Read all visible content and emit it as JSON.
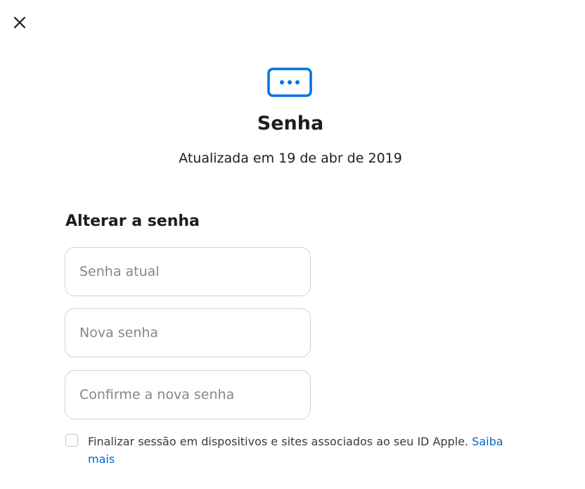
{
  "close": {
    "icon": "close-icon"
  },
  "header": {
    "icon": "password-dots-icon",
    "icon_color": "#0071e3",
    "title": "Senha",
    "subtitle": "Atualizada em 19 de abr de 2019"
  },
  "form": {
    "heading": "Alterar a senha",
    "current_password": {
      "placeholder": "Senha atual",
      "value": ""
    },
    "new_password": {
      "placeholder": "Nova senha",
      "value": ""
    },
    "confirm_password": {
      "placeholder": "Confirme a nova senha",
      "value": ""
    },
    "signout": {
      "checked": false,
      "label": "Finalizar sessão em dispositivos e sites associados ao seu ID Apple.",
      "link_text": "Saiba mais"
    }
  },
  "colors": {
    "accent": "#0071e3",
    "link": "#0066cc",
    "field_border": "#d2d2d7",
    "placeholder": "#86868b"
  }
}
